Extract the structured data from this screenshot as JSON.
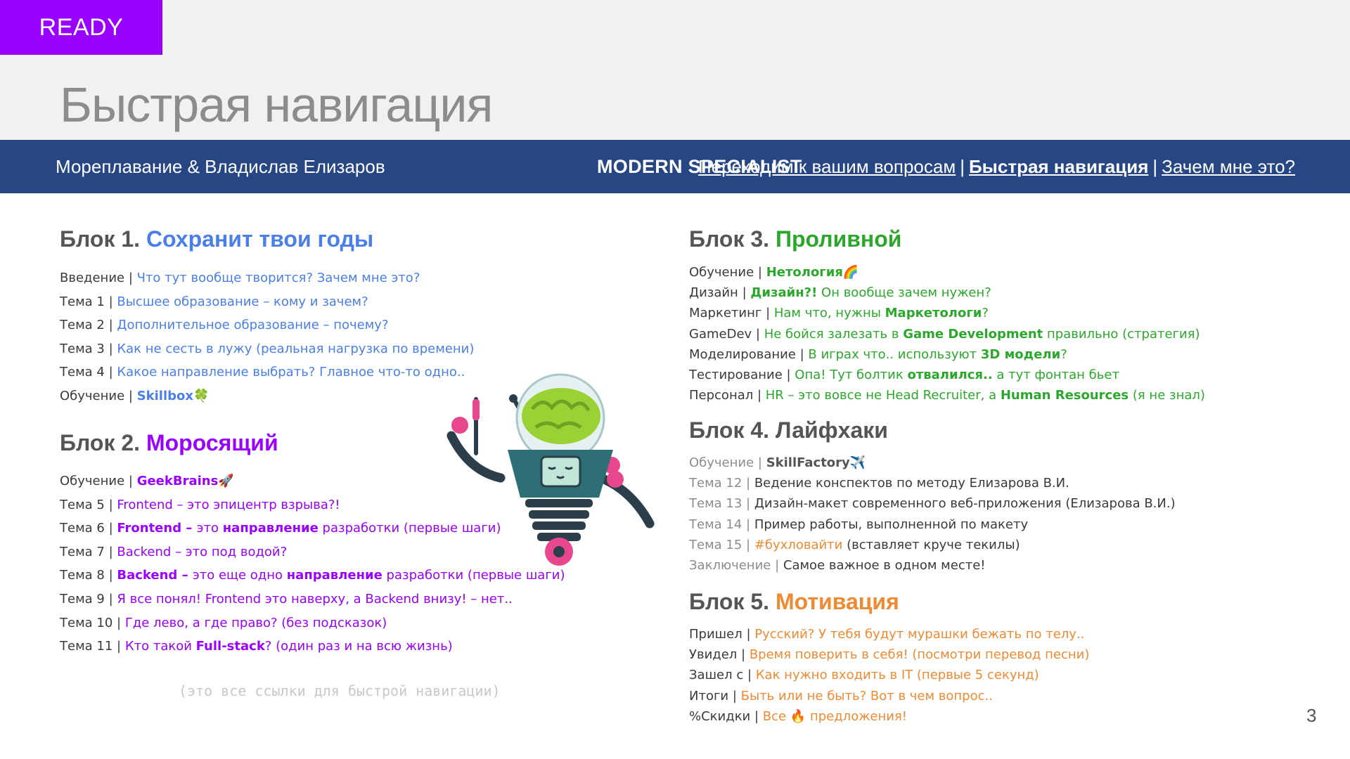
{
  "badge": "READY",
  "page_title": "Быстрая навигация",
  "nav": {
    "left": "Мореплавание & Владислав Елизаров",
    "center": "MODERN SPECIALIST",
    "links": [
      "Переходим к вашим вопросам",
      "Быстрая навигация",
      "Зачем мне это?"
    ],
    "separator": "|"
  },
  "colors": {
    "badge": "#9900ff",
    "nav_bar": "#274684",
    "block1": "#4a7ee8",
    "block2": "#9900ff",
    "block3": "#2ba82b",
    "block4": "#555555",
    "block5": "#ee8a32"
  },
  "sep": " | ",
  "block1": {
    "label": "Блок 1.",
    "name": "Сохранит твои годы",
    "items": [
      {
        "prefix": "Введение",
        "text": "Что тут вообще творится? Зачем мне это?"
      },
      {
        "prefix": "Тема 1",
        "text": "Высшее образование – кому и зачем?"
      },
      {
        "prefix": "Тема 2",
        "text": "Дополнительное образование – почему?"
      },
      {
        "prefix": "Тема 3",
        "text": "Как не сесть в лужу (реальная нагрузка по времени)"
      },
      {
        "prefix": "Тема 4",
        "text": "Какое направление выбрать? Главное что-то одно.."
      },
      {
        "prefix": "Обучение",
        "text": "Skillbox",
        "icon": "🍀"
      }
    ]
  },
  "block2": {
    "label": "Блок 2.",
    "name": "Моросящий",
    "items": [
      {
        "prefix": "Обучение",
        "text": "GeekBrains",
        "icon": "🚀"
      },
      {
        "prefix": "Тема 5",
        "text": "Frontend – это эпицентр взрыва?!"
      },
      {
        "prefix": "Тема 6",
        "p1": "Frontend – ",
        "p2": "это ",
        "p3": "направление",
        "p4": " разработки (первые шаги)"
      },
      {
        "prefix": "Тема 7",
        "text": "Backend – это под водой?"
      },
      {
        "prefix": "Тема 8",
        "p1": "Backend – ",
        "p2": "это еще одно ",
        "p3": "направление",
        "p4": " разработки (первые шаги)"
      },
      {
        "prefix": "Тема 9",
        "text": "Я все понял! Frontend это наверху, а Backend внизу! – нет.."
      },
      {
        "prefix": "Тема 10",
        "text": "Где лево, а где право? (без подсказок)"
      },
      {
        "prefix": "Тема 11",
        "p1": "Кто такой ",
        "p2": "Full-stack",
        "p3": "? (один раз и на всю жизнь)"
      }
    ]
  },
  "block3": {
    "label": "Блок 3.",
    "name": "Проливной",
    "items": [
      {
        "prefix": "Обучение",
        "text": "Нетология",
        "icon": "🌈"
      },
      {
        "prefix": "Дизайн",
        "p1": "Дизайн?!",
        "p2": " Он вообще зачем нужен?"
      },
      {
        "prefix": "Маркетинг",
        "p1": "Нам что, нужны ",
        "p2": "Маркетологи",
        "p3": "?"
      },
      {
        "prefix": "GameDev",
        "p1": "Не бойся залезать в ",
        "p2": "Game Development",
        "p3": " правильно (стратегия)"
      },
      {
        "prefix": "Моделирование",
        "p1": "В играх что.. используют ",
        "p2": "3D модели",
        "p3": "?"
      },
      {
        "prefix": "Тестирование",
        "p1": "Опа! Тут болтик ",
        "p2": "отвалился..",
        "p3": " а тут фонтан бьет"
      },
      {
        "prefix": "Персонал",
        "p1": "HR – это вовсе не Head Recruiter, а ",
        "p2": "Human Resources",
        "p3": " (я не знал)"
      }
    ]
  },
  "block4": {
    "label": "Блок 4.",
    "name": "Лайфхаки",
    "items": [
      {
        "prefix": "Обучение",
        "text": "SkillFactory",
        "icon": "✈️"
      },
      {
        "prefix": "Тема 12",
        "text": "Ведение конспектов по методу Елизарова В.И."
      },
      {
        "prefix": "Тема 13",
        "text": "Дизайн-макет современного веб-приложения (Елизарова В.И.)"
      },
      {
        "prefix": "Тема 14",
        "text": "Пример работы, выполненной по макету"
      },
      {
        "prefix": "Тема 15",
        "p1": "#бухловайти",
        "p2": " (вставляет круче текилы)"
      },
      {
        "prefix": "Заключение",
        "text": "Самое важное в одном месте!"
      }
    ]
  },
  "block5": {
    "label": "Блок 5.",
    "name": "Мотивация",
    "items": [
      {
        "prefix": "Пришел",
        "text": "Русский? У тебя будут мурашки бежать по телу.."
      },
      {
        "prefix": "Увидел",
        "text": "Время поверить в себя! (посмотри перевод песни)"
      },
      {
        "prefix": "Зашел с",
        "text": "Как нужно входить в IT (первые 5 секунд)"
      },
      {
        "prefix": "Итоги",
        "text": "Быть или не быть? Вот в чем вопрос.."
      },
      {
        "prefix": "%Скидки",
        "p1": "Все ",
        "p2": "🔥",
        "p3": " предложения!"
      }
    ]
  },
  "footnote": "(это все ссылки для быстрой навигации)",
  "page_number": "3"
}
